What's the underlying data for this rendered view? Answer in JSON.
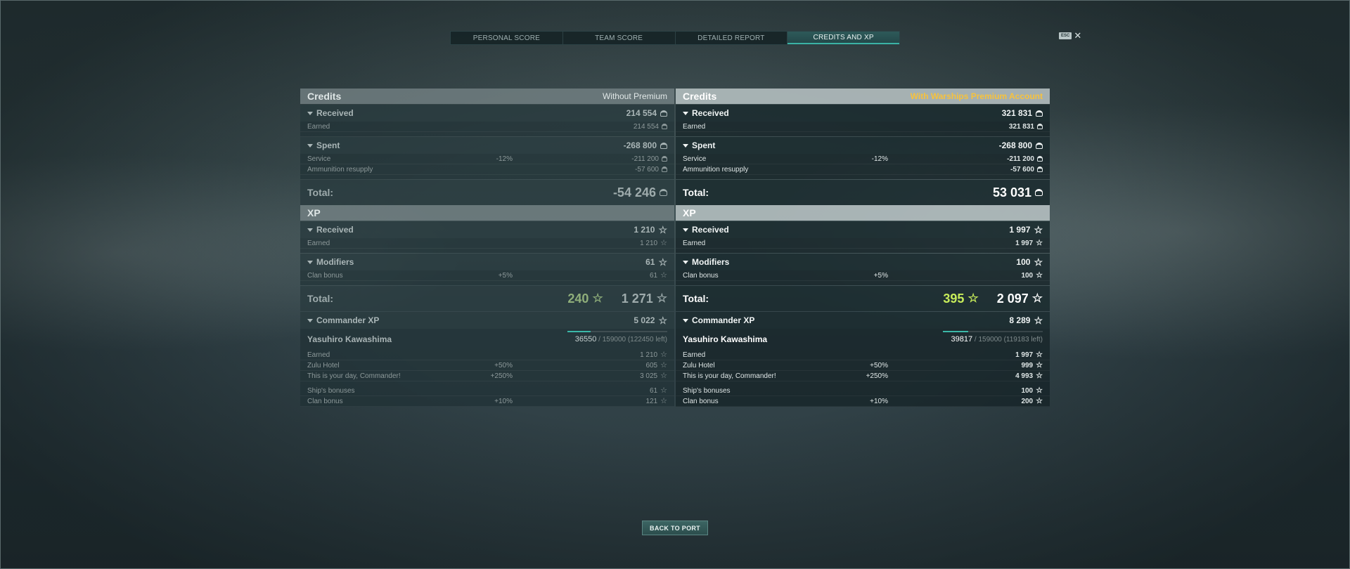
{
  "tabs": [
    "PERSONAL SCORE",
    "TEAM SCORE",
    "DETAILED REPORT",
    "CREDITS AND XP"
  ],
  "active_tab": "CREDITS AND XP",
  "esc": {
    "key": "ESC",
    "close": "✕"
  },
  "columns": {
    "left": {
      "credits_header": "Credits",
      "account": "Without Premium",
      "received": {
        "label": "Received",
        "value": "214 554"
      },
      "earned": {
        "label": "Earned",
        "value": "214 554"
      },
      "spent": {
        "label": "Spent",
        "value": "-268 800"
      },
      "service": {
        "label": "Service",
        "pct": "-12%",
        "value": "-211 200"
      },
      "ammo": {
        "label": "Ammunition resupply",
        "value": "-57 600"
      },
      "credits_total": {
        "label": "Total:",
        "value": "-54 246"
      },
      "xp_header": "XP",
      "xp_received": {
        "label": "Received",
        "value": "1 210"
      },
      "xp_earned": {
        "label": "Earned",
        "value": "1 210"
      },
      "modifiers": {
        "label": "Modifiers",
        "value": "61"
      },
      "clan": {
        "label": "Clan bonus",
        "pct": "+5%",
        "value": "61"
      },
      "xp_total": {
        "label": "Total:",
        "bonus": "240",
        "value": "1 271"
      },
      "commander": {
        "label": "Commander XP",
        "value": "5 022"
      },
      "cmdr_name": "Yasuhiro Kawashima",
      "cmdr_progress": {
        "current": "36550",
        "rest": "/ 159000 (122450 left)",
        "fraction": 0.23
      },
      "cmdr_earned": {
        "label": "Earned",
        "value": "1 210"
      },
      "zulu": {
        "label": "Zulu Hotel",
        "pct": "+50%",
        "value": "605"
      },
      "day": {
        "label": "This is your day, Commander!",
        "pct": "+250%",
        "value": "3 025"
      },
      "ship_bonus": {
        "label": "Ship's bonuses",
        "value": "61"
      },
      "cmdr_clan": {
        "label": "Clan bonus",
        "pct": "+10%",
        "value": "121"
      }
    },
    "right": {
      "credits_header": "Credits",
      "account": "With Warships Premium Account",
      "received": {
        "label": "Received",
        "value": "321 831"
      },
      "earned": {
        "label": "Earned",
        "value": "321 831"
      },
      "spent": {
        "label": "Spent",
        "value": "-268 800"
      },
      "service": {
        "label": "Service",
        "pct": "-12%",
        "value": "-211 200"
      },
      "ammo": {
        "label": "Ammunition resupply",
        "value": "-57 600"
      },
      "credits_total": {
        "label": "Total:",
        "value": "53 031"
      },
      "xp_header": "XP",
      "xp_received": {
        "label": "Received",
        "value": "1 997"
      },
      "xp_earned": {
        "label": "Earned",
        "value": "1 997"
      },
      "modifiers": {
        "label": "Modifiers",
        "value": "100"
      },
      "clan": {
        "label": "Clan bonus",
        "pct": "+5%",
        "value": "100"
      },
      "xp_total": {
        "label": "Total:",
        "bonus": "395",
        "value": "2 097"
      },
      "commander": {
        "label": "Commander XP",
        "value": "8 289"
      },
      "cmdr_name": "Yasuhiro Kawashima",
      "cmdr_progress": {
        "current": "39817",
        "rest": "/ 159000 (119183 left)",
        "fraction": 0.25
      },
      "cmdr_earned": {
        "label": "Earned",
        "value": "1 997"
      },
      "zulu": {
        "label": "Zulu Hotel",
        "pct": "+50%",
        "value": "999"
      },
      "day": {
        "label": "This is your day, Commander!",
        "pct": "+250%",
        "value": "4 993"
      },
      "ship_bonus": {
        "label": "Ship's bonuses",
        "value": "100"
      },
      "cmdr_clan": {
        "label": "Clan bonus",
        "pct": "+10%",
        "value": "200"
      }
    }
  },
  "back_button": "BACK TO PORT"
}
